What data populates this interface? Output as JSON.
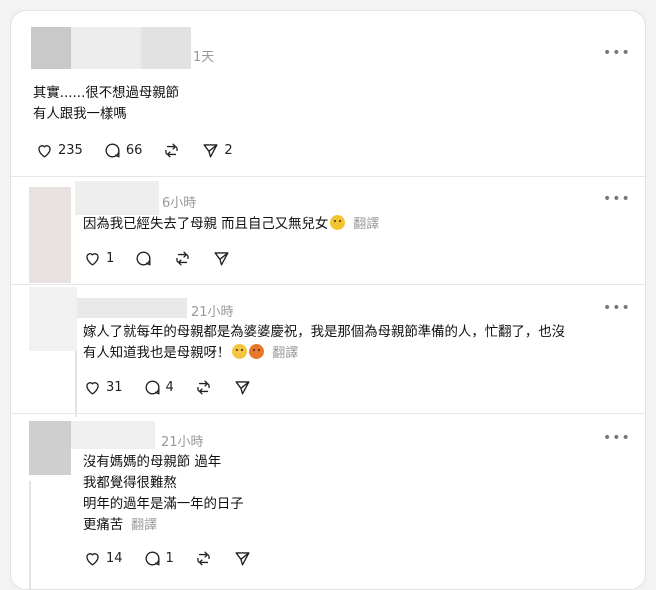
{
  "posts": [
    {
      "time": "1天",
      "lines": [
        "其實......很不想過母親節",
        "有人跟我一樣嗎"
      ],
      "likes": "235",
      "comments": "66",
      "reposts": "",
      "shares": "2"
    },
    {
      "time": "6小時",
      "lines": [
        "因為我已經失去了母親 而且自己又無兒女"
      ],
      "translate": "翻譯",
      "likes": "1",
      "comments": "",
      "reposts": "",
      "shares": ""
    },
    {
      "time": "21小時",
      "lines": [
        "嫁人了就每年的母親都是為婆婆慶祝，我是那個為母親節準備的人，忙翻了，也沒",
        "有人知道我也是母親呀！"
      ],
      "translate": "翻譯",
      "likes": "31",
      "comments": "4",
      "reposts": "",
      "shares": ""
    },
    {
      "time": "21小時",
      "lines": [
        "沒有媽媽的母親節 過年",
        "我都覺得很難熬",
        "明年的過年是滿一年的日子",
        "更痛苦"
      ],
      "translate": "翻譯",
      "likes": "14",
      "comments": "1",
      "reposts": "",
      "shares": ""
    }
  ],
  "icons": {
    "more": "more-icon",
    "like": "heart-icon",
    "comment": "comment-icon",
    "repost": "repost-icon",
    "share": "send-icon"
  },
  "colors": {
    "text": "#111111",
    "muted": "#999999",
    "divider": "#e6e6e6",
    "background": "#ffffff"
  }
}
